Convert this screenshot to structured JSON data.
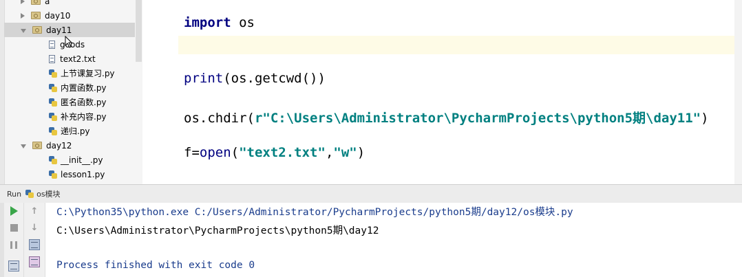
{
  "project_tree": {
    "items": [
      {
        "label": "a",
        "type": "folder",
        "expanded": false
      },
      {
        "label": "day10",
        "type": "folder",
        "expanded": false
      },
      {
        "label": "day11",
        "type": "folder",
        "expanded": true,
        "selected": true
      },
      {
        "label": "goods",
        "type": "file"
      },
      {
        "label": "text2.txt",
        "type": "file"
      },
      {
        "label": "上节课复习.py",
        "type": "python"
      },
      {
        "label": "内置函数.py",
        "type": "python"
      },
      {
        "label": "匿名函数.py",
        "type": "python"
      },
      {
        "label": "补充内容.py",
        "type": "python"
      },
      {
        "label": "递归.py",
        "type": "python"
      },
      {
        "label": "day12",
        "type": "folder",
        "expanded": true
      },
      {
        "label": "__init__.py",
        "type": "python"
      },
      {
        "label": "lesson1.py",
        "type": "python"
      }
    ]
  },
  "editor": {
    "lines": {
      "l1_kw": "import",
      "l1_rest": " os",
      "l3_fn": "print",
      "l3_rest": "(os.getcwd())",
      "l4_a": "os.chdir(",
      "l4_str": "r\"C:\\Users\\Administrator\\PycharmProjects\\python5期\\day11\"",
      "l4_b": ")",
      "l5_a": "f=",
      "l5_fn": "open",
      "l5_b": "(",
      "l5_s1": "\"text2.txt\"",
      "l5_c": ",",
      "l5_s2": "\"w\"",
      "l5_d": ")"
    }
  },
  "run_panel": {
    "header_label": "Run",
    "config_name": "os模块",
    "output": [
      "C:\\Python35\\python.exe C:/Users/Administrator/PycharmProjects/python5期/day12/os模块.py",
      "C:\\Users\\Administrator\\PycharmProjects\\python5期\\day12",
      "Process finished with exit code 0"
    ]
  },
  "colors": {
    "keyword": "#000080",
    "string": "#008080",
    "console_cmd": "#1a3c8c",
    "selection": "#d4d4d4",
    "current_line": "#fefbe6"
  }
}
